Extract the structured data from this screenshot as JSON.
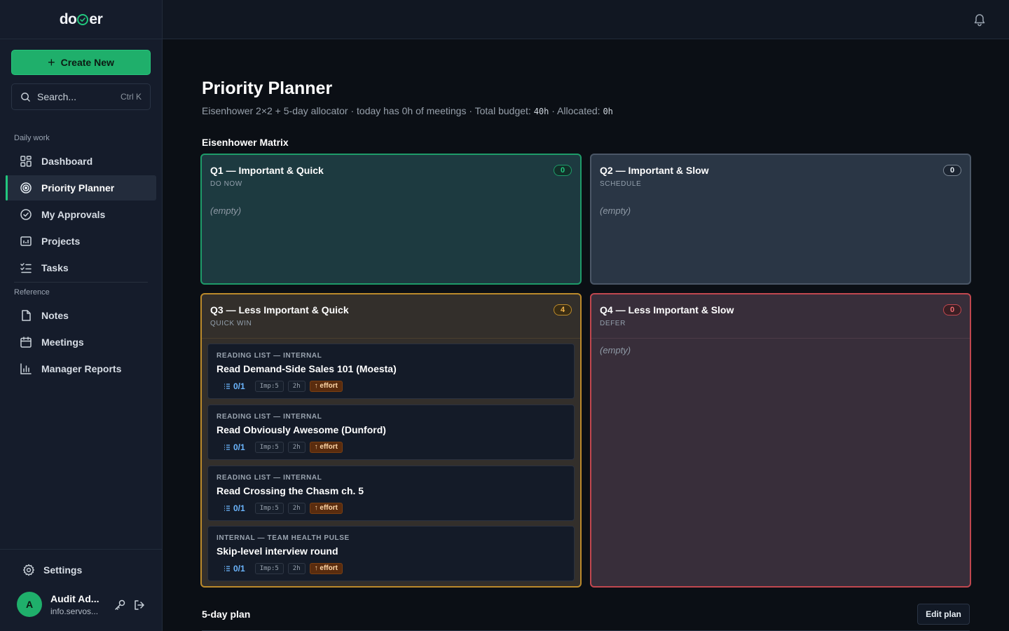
{
  "app": {
    "logo_left": "do",
    "logo_right": "er",
    "brand_color": "#22c77e"
  },
  "sidebar": {
    "create_label": "Create New",
    "search_placeholder": "Search...",
    "search_shortcut": "Ctrl K",
    "sections": {
      "daily": "Daily work",
      "reference": "Reference"
    },
    "items": [
      {
        "label": "Dashboard",
        "icon": "dashboard-grid-icon"
      },
      {
        "label": "Priority Planner",
        "icon": "target-icon",
        "active": true
      },
      {
        "label": "My Approvals",
        "icon": "check-circle-icon"
      },
      {
        "label": "Projects",
        "icon": "projects-chart-icon"
      },
      {
        "label": "Tasks",
        "icon": "checklist-icon"
      },
      {
        "label": "Notes",
        "icon": "file-icon"
      },
      {
        "label": "Meetings",
        "icon": "calendar-icon"
      },
      {
        "label": "Manager Reports",
        "icon": "bar-chart-icon"
      }
    ],
    "settings_label": "Settings",
    "user": {
      "initial": "A",
      "name": "Audit Ad...",
      "email": "info.servos..."
    }
  },
  "page": {
    "title": "Priority Planner",
    "subtitle_prefix": "Eisenhower 2×2 + 5-day allocator · today has 0h of meetings · Total budget: ",
    "budget": "40h",
    "subtitle_mid": " · Allocated: ",
    "allocated": "0h",
    "matrix_title": "Eisenhower Matrix",
    "plan_title": "5-day plan",
    "edit_plan_label": "Edit plan"
  },
  "quadrants": {
    "q1": {
      "title": "Q1 — Important & Quick",
      "sub": "DO NOW",
      "count": "0",
      "empty": "(empty)"
    },
    "q2": {
      "title": "Q2 — Important & Slow",
      "sub": "SCHEDULE",
      "count": "0",
      "empty": "(empty)"
    },
    "q3": {
      "title": "Q3 — Less Important & Quick",
      "sub": "QUICK WIN",
      "count": "4",
      "tasks": [
        {
          "category": "READING LIST — INTERNAL",
          "title": "Read Demand-Side Sales 101 (Moesta)",
          "subtasks": "0/1",
          "imp": "Imp:5",
          "hours": "2h",
          "effort": "↑ effort"
        },
        {
          "category": "READING LIST — INTERNAL",
          "title": "Read Obviously Awesome (Dunford)",
          "subtasks": "0/1",
          "imp": "Imp:5",
          "hours": "2h",
          "effort": "↑ effort"
        },
        {
          "category": "READING LIST — INTERNAL",
          "title": "Read Crossing the Chasm ch. 5",
          "subtasks": "0/1",
          "imp": "Imp:5",
          "hours": "2h",
          "effort": "↑ effort"
        },
        {
          "category": "INTERNAL — TEAM HEALTH PULSE",
          "title": "Skip-level interview round",
          "subtasks": "0/1",
          "imp": "Imp:5",
          "hours": "2h",
          "effort": "↑ effort"
        }
      ]
    },
    "q4": {
      "title": "Q4 — Less Important & Slow",
      "sub": "DEFER",
      "count": "0",
      "empty": "(empty)"
    }
  }
}
